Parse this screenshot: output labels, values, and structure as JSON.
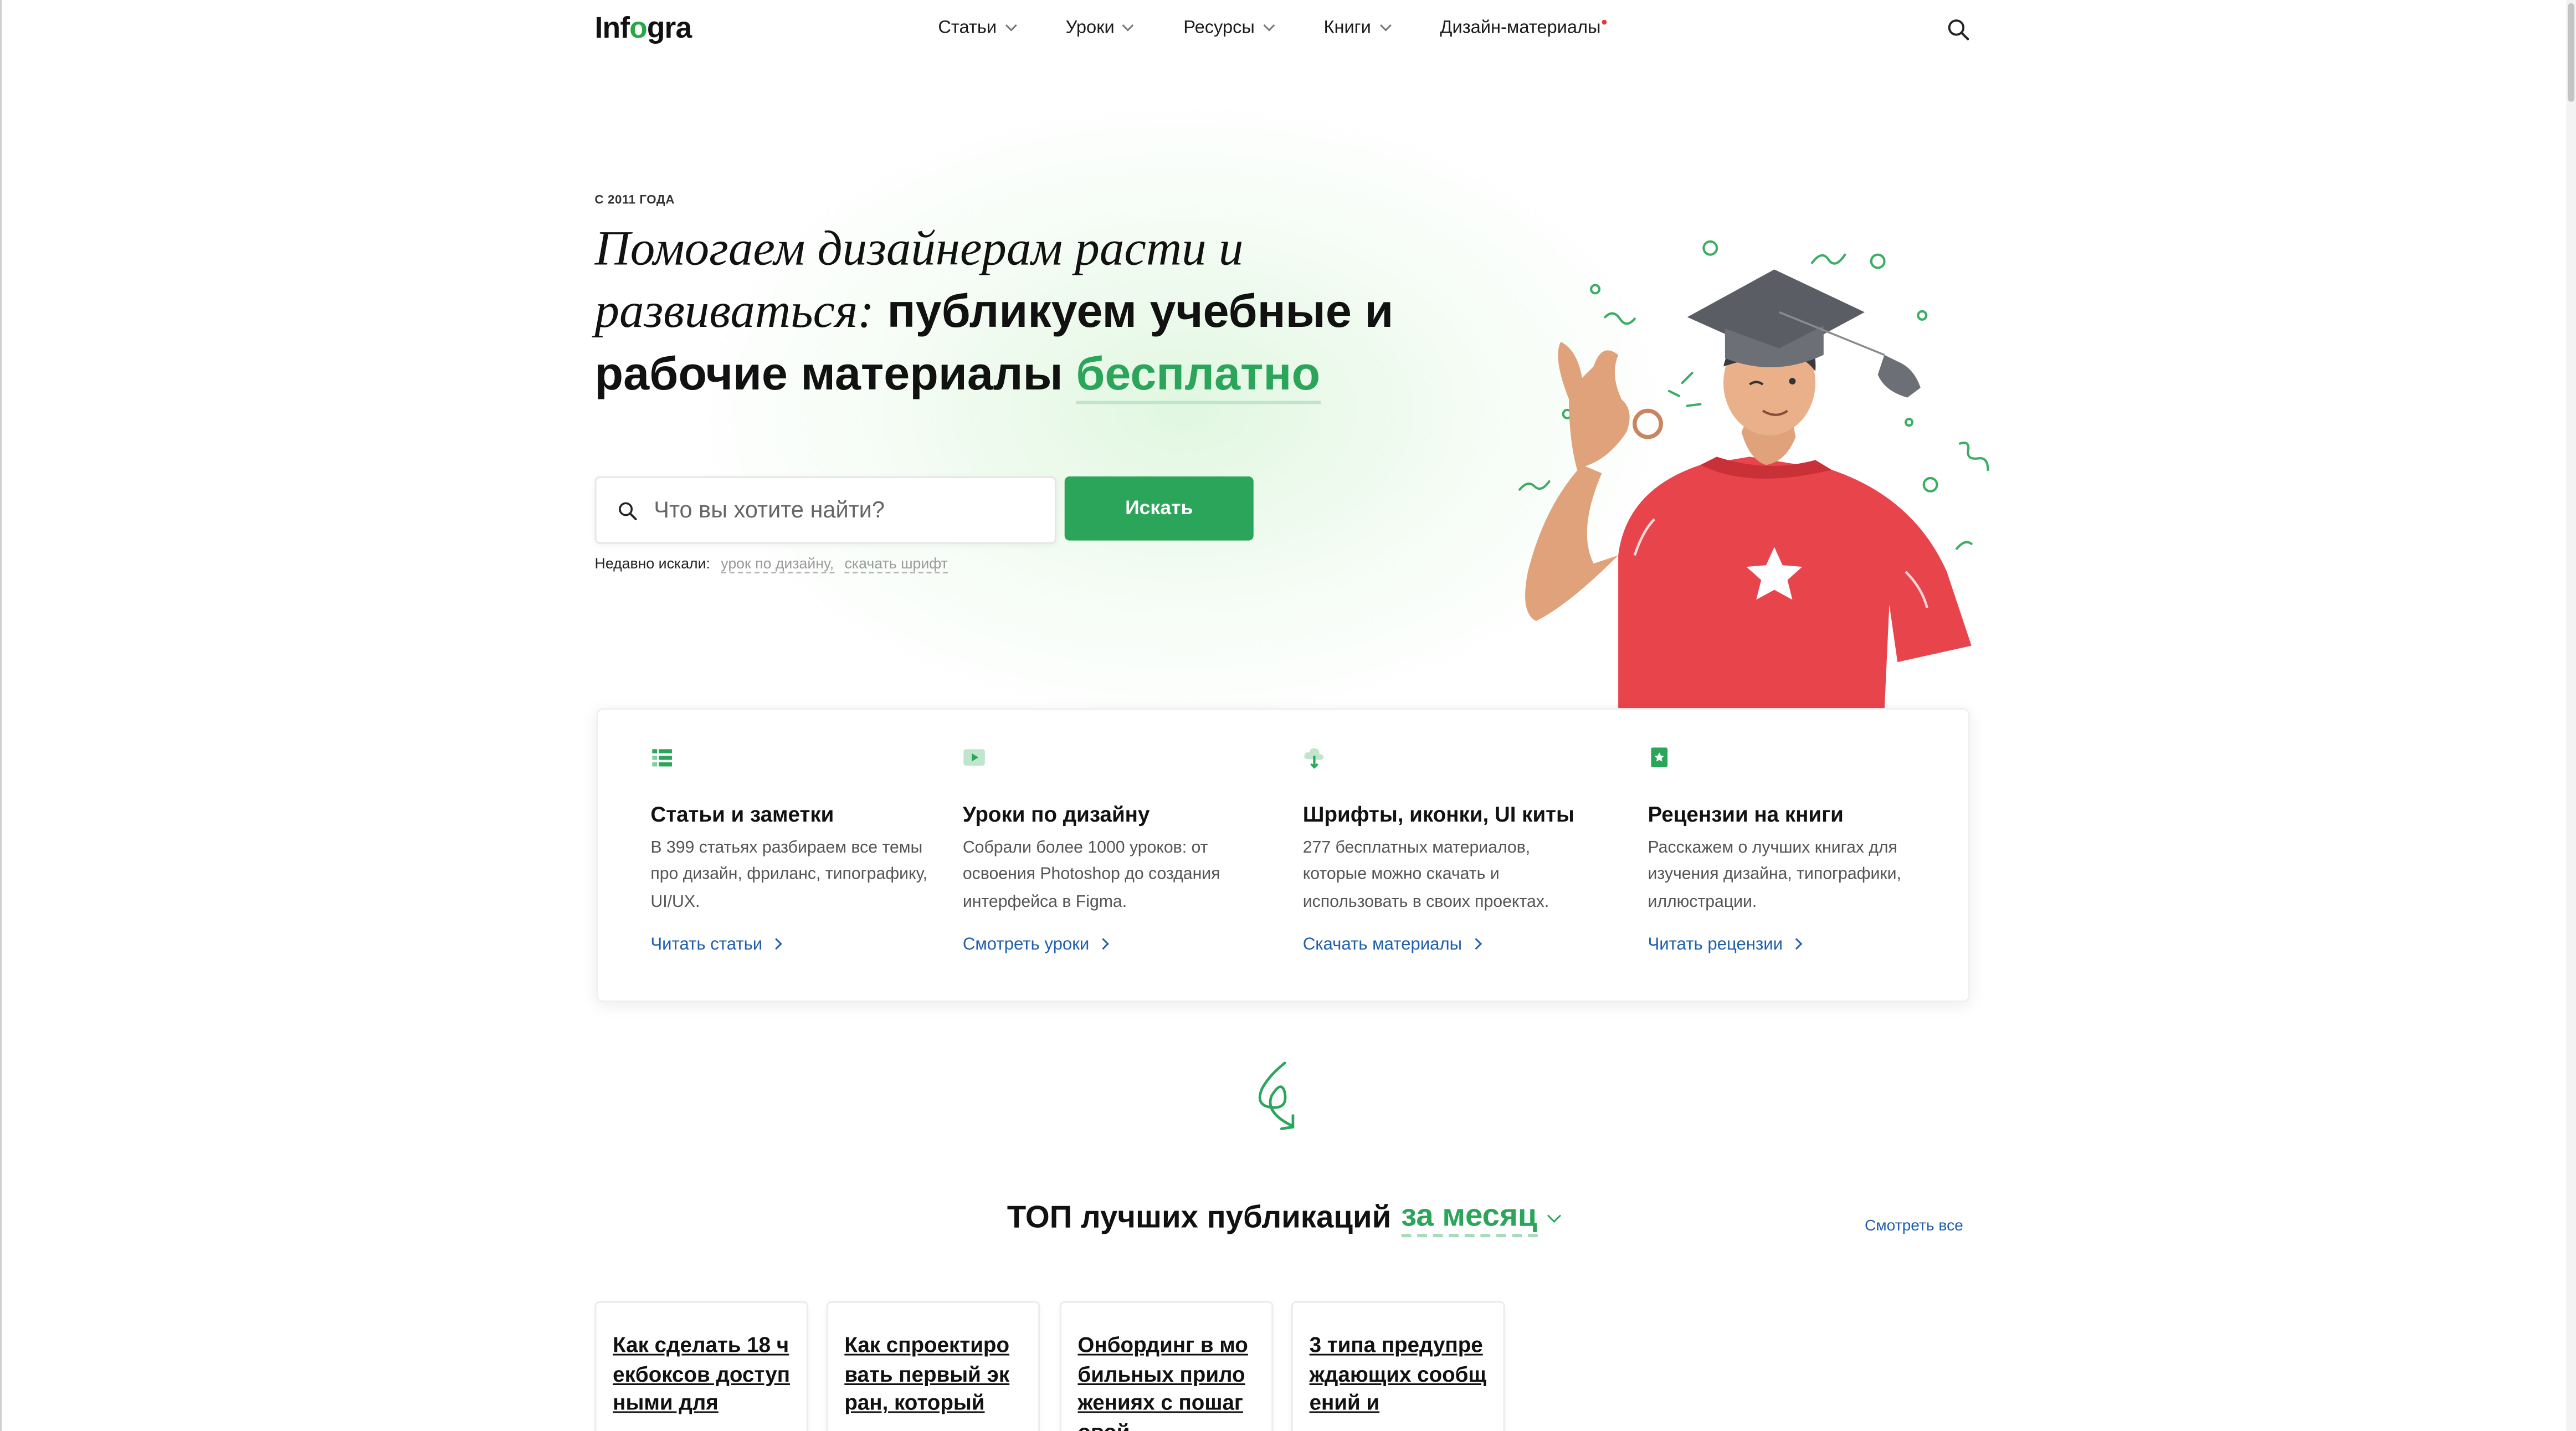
{
  "header": {
    "logo_prefix": "Inf",
    "logo_o": "o",
    "logo_suffix": "gra",
    "nav": [
      {
        "label": "Статьи"
      },
      {
        "label": "Уроки"
      },
      {
        "label": "Ресурсы"
      },
      {
        "label": "Книги"
      },
      {
        "label": "Дизайн-материалы"
      }
    ]
  },
  "hero": {
    "since": "С 2011 ГОДА",
    "headline_italic": "Помогаем дизайнерам расти и развиваться:",
    "headline_bold": " публикуем учебные и рабочие материалы ",
    "headline_green": "бесплатно",
    "search_placeholder": "Что вы хотите найти?",
    "search_button": "Искать",
    "recent_label": "Недавно искали:",
    "recent_items": [
      "урок по дизайну,",
      "скачать шрифт"
    ]
  },
  "features": [
    {
      "title": "Статьи и заметки",
      "desc": "В 399 статьях разбираем все темы про дизайн, фриланс, типографику, UI/UX.",
      "link": "Читать статьи",
      "icon": "list-icon"
    },
    {
      "title": "Уроки по дизайну",
      "desc": "Собрали более 1000 уроков: от освоения Photoshop до создания интерфейса в Figma.",
      "link": "Смотреть уроки",
      "icon": "video-icon"
    },
    {
      "title": "Шрифты, иконки, UI киты",
      "desc": "277 бесплатных материалов, которые можно скачать и использовать в своих проектах.",
      "link": "Скачать материалы",
      "icon": "download-cloud-icon"
    },
    {
      "title": "Рецензии на книги",
      "desc": "Расскажем о лучших книгах для изучения дизайна, типографики, иллюстрации.",
      "link": "Читать рецензии",
      "icon": "book-icon"
    }
  ],
  "top": {
    "title": "ТОП лучших публикаций",
    "period": "за месяц",
    "see_all": "Смотреть все",
    "cards": [
      {
        "title": "Как сделать 18 чекбоксов доступными для"
      },
      {
        "title": "Как спроектировать первый экран, который"
      },
      {
        "title": "Онбординг в мобильных приложениях с пошаговой"
      },
      {
        "title": "3 типа предупреждающих сообщений и"
      }
    ]
  },
  "colors": {
    "accent": "#2aa55a",
    "link": "#1f5fae"
  }
}
